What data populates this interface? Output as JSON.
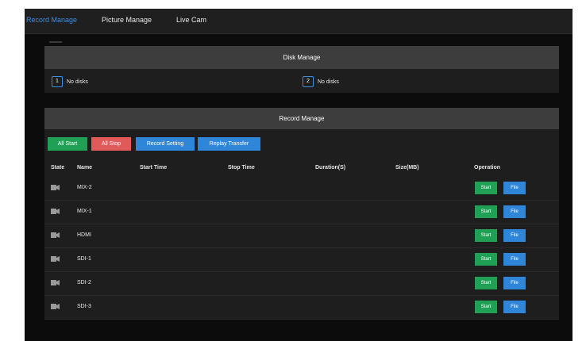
{
  "nav": {
    "tabs": [
      {
        "label": "Record Manage",
        "active": true
      },
      {
        "label": "Picture Manage",
        "active": false
      },
      {
        "label": "Live Cam",
        "active": false
      }
    ]
  },
  "disk_manage": {
    "title": "Disk Manage",
    "disks": [
      {
        "number": "1",
        "status": "No disks"
      },
      {
        "number": "2",
        "status": "No disks"
      }
    ]
  },
  "record_manage": {
    "title": "Record Manage",
    "buttons": {
      "all_start": "All Start",
      "all_stop": "All Stop",
      "record_setting": "Record Setting",
      "replay_transfer": "Replay Transfer"
    },
    "columns": {
      "state": "State",
      "name": "Name",
      "start_time": "Start Time",
      "stop_time": "Stop Time",
      "duration": "Duration(S)",
      "size": "Size(MB)",
      "operation": "Operation"
    },
    "rows": [
      {
        "name": "MIX-2",
        "start_label": "Start",
        "file_label": "File"
      },
      {
        "name": "MIX-1",
        "start_label": "Start",
        "file_label": "File"
      },
      {
        "name": "HDMI",
        "start_label": "Start",
        "file_label": "File"
      },
      {
        "name": "SDI-1",
        "start_label": "Start",
        "file_label": "File"
      },
      {
        "name": "SDI-2",
        "start_label": "Start",
        "file_label": "File"
      },
      {
        "name": "SDI-3",
        "start_label": "Start",
        "file_label": "File"
      }
    ],
    "state_icon": "camera-icon"
  },
  "colors": {
    "accent": "#3d8ee6",
    "start_green": "#1fa055",
    "stop_red": "#e05a5a",
    "button_blue": "#2f86d8"
  }
}
